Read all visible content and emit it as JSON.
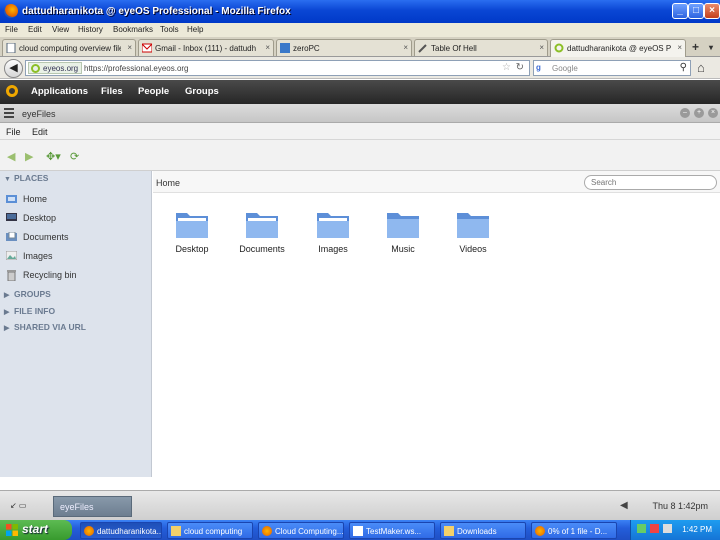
{
  "browser": {
    "window_title": "dattudharanikota @ eyeOS Professional - Mozilla Firefox",
    "menu": [
      "File",
      "Edit",
      "View",
      "History",
      "Bookmarks",
      "Tools",
      "Help"
    ],
    "tabs": [
      {
        "label": "cloud computing overview file"
      },
      {
        "label": "Gmail - Inbox (111) - dattudh"
      },
      {
        "label": "zeroPC"
      },
      {
        "label": "Table Of Hell"
      },
      {
        "label": "dattudharanikota @ eyeOS P"
      }
    ],
    "identity": "eyeos.org",
    "url": "https://professional.eyeos.org",
    "search_placeholder": "Google",
    "window_controls": {
      "minimize": "_",
      "maximize": "□",
      "close": "×"
    }
  },
  "eyeos": {
    "top_menu": [
      "Applications",
      "Files",
      "People",
      "Groups"
    ]
  },
  "files_window": {
    "title": "eyeFiles",
    "menu": [
      "File",
      "Edit"
    ],
    "sidebar": {
      "places_title": "PLACES",
      "places": [
        {
          "label": "Home",
          "icon": "home-folder-icon"
        },
        {
          "label": "Desktop",
          "icon": "desktop-icon"
        },
        {
          "label": "Documents",
          "icon": "documents-icon"
        },
        {
          "label": "Images",
          "icon": "images-icon"
        },
        {
          "label": "Recycling bin",
          "icon": "trash-icon"
        }
      ],
      "sections": [
        "GROUPS",
        "FILE INFO",
        "SHARED VIA URL"
      ]
    },
    "breadcrumb": "Home",
    "search_placeholder": "Search",
    "folders": [
      {
        "label": "Desktop"
      },
      {
        "label": "Documents"
      },
      {
        "label": "Images"
      },
      {
        "label": "Music"
      },
      {
        "label": "Videos"
      }
    ]
  },
  "eyeos_taskbar": {
    "task": "eyeFiles",
    "clock": "Thu 8 1:42pm"
  },
  "windows_taskbar": {
    "start_label": "start",
    "buttons": [
      {
        "label": "dattudharanikota..."
      },
      {
        "label": "cloud computing"
      },
      {
        "label": "Cloud Computing..."
      },
      {
        "label": "TestMaker.ws..."
      },
      {
        "label": "Downloads"
      },
      {
        "label": "0% of 1 file - D..."
      }
    ],
    "clock": "1:42 PM"
  }
}
